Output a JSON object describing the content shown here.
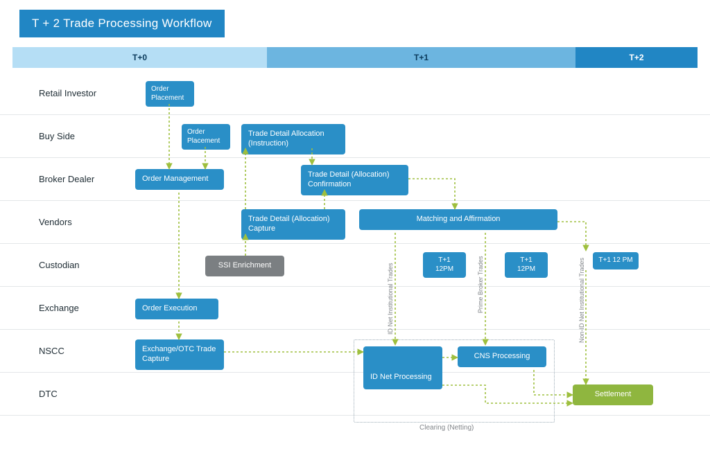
{
  "title": "T + 2 Trade Processing Workflow",
  "periods": {
    "t0": "T+0",
    "t1": "T+1",
    "t2": "T+2"
  },
  "lanes": {
    "retail": "Retail Investor",
    "buyside": "Buy Side",
    "broker": "Broker Dealer",
    "vendors": "Vendors",
    "custodian": "Custodian",
    "exchange": "Exchange",
    "nscc": "NSCC",
    "dtc": "DTC"
  },
  "nodes": {
    "order_placement_retail": "Order Placement",
    "order_placement_buy": "Order Placement",
    "trade_detail_alloc_instruction": "Trade Detail Allocation (Instruction)",
    "order_management": "Order Management",
    "trade_detail_alloc_confirmation": "Trade Detail (Allocation) Confirmation",
    "trade_detail_alloc_capture": "Trade Detail (Allocation) Capture",
    "matching_affirmation": "Matching and Affirmation",
    "ssi_enrichment": "SSI Enrichment",
    "t1_12pm_a": "T+1 12PM",
    "t1_12pm_b": "T+1 12PM",
    "t1_12pm_c": "T+1 12 PM",
    "order_execution": "Order Execution",
    "otc_capture": "Exchange/OTC Trade Capture",
    "id_net_processing": "ID Net Processing",
    "cns_processing": "CNS Processing",
    "settlement": "Settlement"
  },
  "vlabels": {
    "id_net_inst": "ID Net Institutional Trades",
    "prime_broker": "Prime Broker Trades",
    "non_id_net_inst": "Non-ID Net Institutional Trades"
  },
  "group": {
    "clearing": "Clearing (Netting)"
  }
}
